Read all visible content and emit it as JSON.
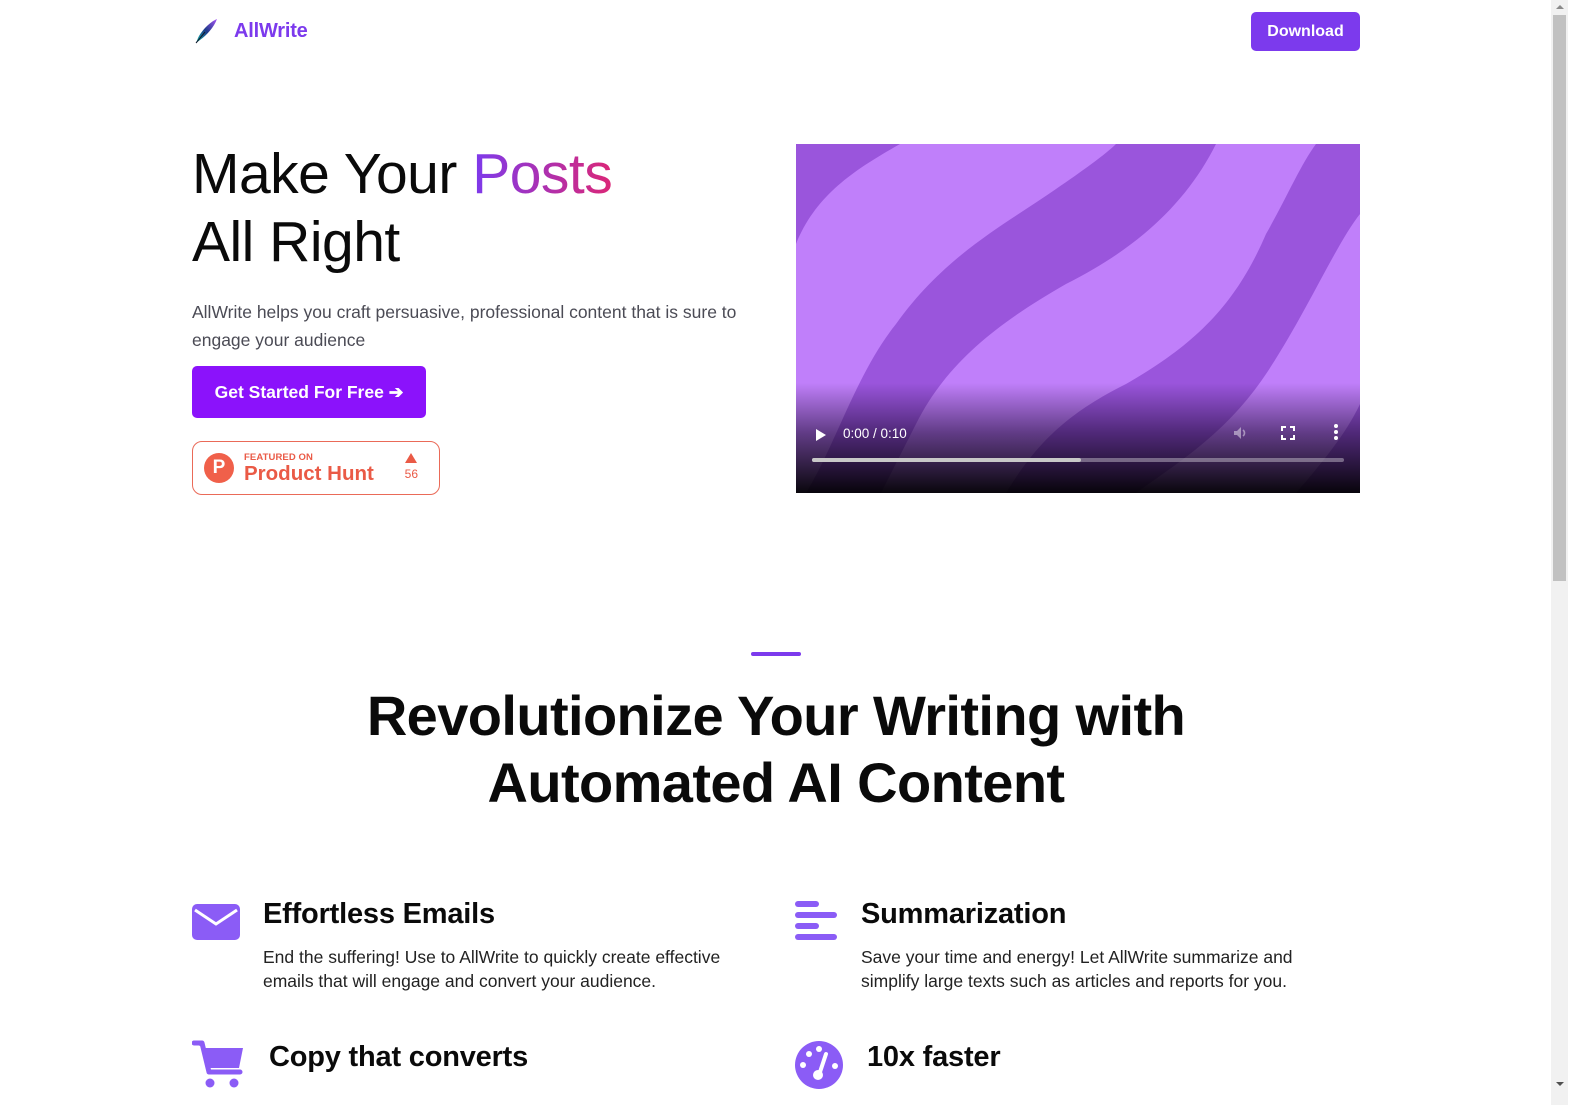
{
  "header": {
    "logo_icon": "quill-pen-icon",
    "brand": "AllWrite",
    "download_label": "Download"
  },
  "hero": {
    "title_part1": "Make Your ",
    "title_accent": "Posts",
    "title_part2": "All Right",
    "subtitle": "AllWrite helps you craft persuasive, professional content that is sure to engage your audience",
    "cta_label": "Get Started For Free ➔",
    "product_hunt": {
      "logo_letter": "P",
      "featured_label": "FEATURED ON",
      "name": "Product Hunt",
      "upvote_icon": "triangle-up-icon",
      "votes": "56"
    }
  },
  "video": {
    "current_time": "0:00",
    "duration": "0:10",
    "time_display": "0:00 / 0:10",
    "buffered_fraction": 0.505,
    "icons": [
      "play-icon",
      "volume-icon",
      "fullscreen-icon",
      "more-options-icon"
    ]
  },
  "features_section": {
    "title_line1": "Revolutionize Your Writing with",
    "title_line2": "Automated AI Content",
    "accent_color": "#7c3aed",
    "items": [
      {
        "icon": "envelope-icon",
        "title": "Effortless Emails",
        "description": "End the suffering! Use to AllWrite to quickly create effective emails that will engage and convert your audience."
      },
      {
        "icon": "text-lines-icon",
        "title": "Summarization",
        "description": "Save your time and energy! Let AllWrite summarize and simplify large texts such as articles and reports for you."
      },
      {
        "icon": "shopping-cart-icon",
        "title": "Copy that converts",
        "description": ""
      },
      {
        "icon": "speedometer-icon",
        "title": "10x faster",
        "description": ""
      }
    ]
  },
  "colors": {
    "brand_purple": "#7c3aed",
    "cta_purple": "#8b12fb",
    "product_hunt": "#ea5a46",
    "icon_purple": "#8b5cf6"
  }
}
